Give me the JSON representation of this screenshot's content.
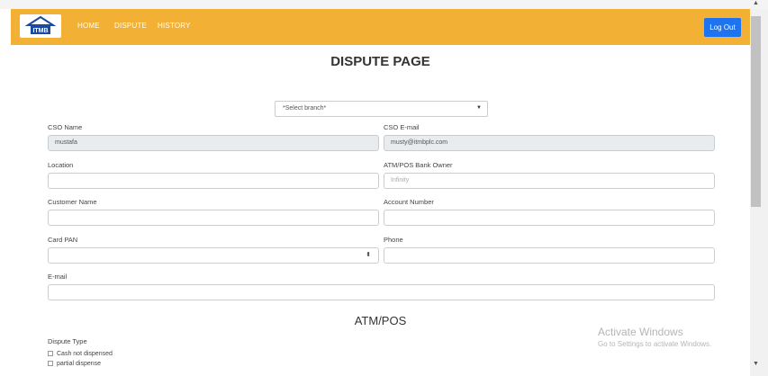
{
  "navbar": {
    "logo_text": "ITMB",
    "links": [
      "HOME",
      "DISPUTE",
      "HISTORY"
    ],
    "logout_label": "Log Out"
  },
  "page": {
    "title": "DISPUTE PAGE",
    "branch_select": "*Select branch*"
  },
  "form": {
    "cso_name_label": "CSO Name",
    "cso_name_value": "mustafa",
    "cso_email_label": "CSO E-mail",
    "cso_email_value": "musty@itmbplc.com",
    "location_label": "Location",
    "location_value": "",
    "bank_owner_label": "ATM/POS Bank Owner",
    "bank_owner_placeholder": "Infinity",
    "customer_name_label": "Customer Name",
    "customer_name_value": "",
    "account_number_label": "Account Number",
    "account_number_value": "",
    "card_pan_label": "Card PAN",
    "card_pan_value": "",
    "phone_label": "Phone",
    "phone_value": "",
    "email_label": "E-mail",
    "email_value": ""
  },
  "atm_section": {
    "title": "ATM/POS",
    "dispute_type_label": "Dispute Type",
    "options": [
      "Cash not dispensed",
      "partial dispense"
    ]
  },
  "watermark": {
    "title": "Activate Windows",
    "subtitle": "Go to Settings to activate Windows."
  },
  "colors": {
    "navbar": "#f2b134",
    "logout_button": "#1d73f0",
    "readonly_field": "#e9ecef"
  }
}
